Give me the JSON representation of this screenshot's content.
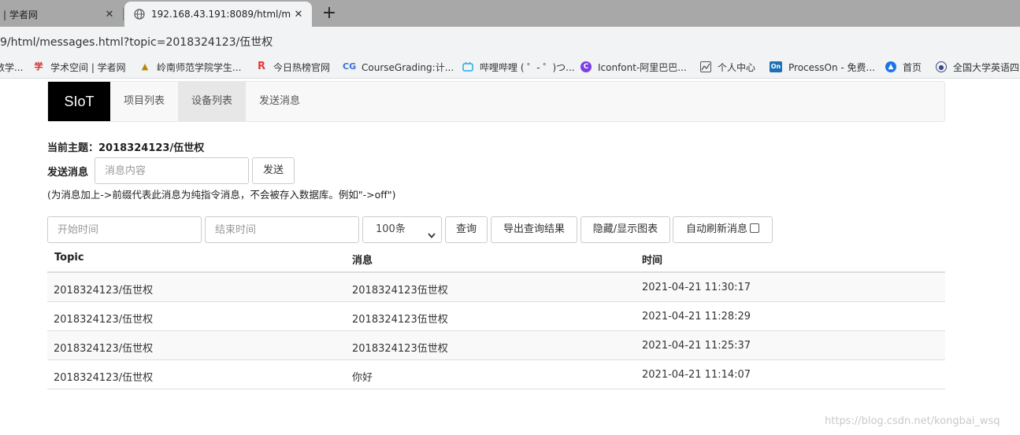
{
  "browser": {
    "tabs": [
      {
        "title": "| 学者网",
        "close": "✕",
        "active": false
      },
      {
        "title": "192.168.43.191:8089/html/me",
        "close": "✕",
        "active": true
      }
    ],
    "new_tab": "+",
    "address": "9/html/messages.html?topic=2018324123/伍世权",
    "bookmarks": [
      {
        "label": "数学...",
        "icon": "partial-icon",
        "color": "#888888"
      },
      {
        "label": "学术空间 | 学者网",
        "icon": "scholar-logo-icon",
        "color": "#d0342c"
      },
      {
        "label": "岭南师范学院学生...",
        "icon": "university-logo-icon",
        "color": "#b8860b"
      },
      {
        "label": "今日热榜官网",
        "icon": "letter-r-icon",
        "color": "#e8383d"
      },
      {
        "label": "CourseGrading:计...",
        "icon": "coursegrading-icon",
        "color": "#3b6fd8"
      },
      {
        "label": "哔哩哔哩 ( ゜- ゜)つ...",
        "icon": "bilibili-icon",
        "color": "#23ade5"
      },
      {
        "label": "Iconfont-阿里巴巴...",
        "icon": "iconfont-icon",
        "color": "#7b3fe4"
      },
      {
        "label": "个人中心",
        "icon": "chart-thumbnail-icon",
        "color": "#555555"
      },
      {
        "label": "ProcessOn - 免费...",
        "icon": "processon-icon",
        "color": "#1d6fb8"
      },
      {
        "label": "首页",
        "icon": "home-logo-icon",
        "color": "#1a73e8"
      },
      {
        "label": "全国大学英语四",
        "icon": "cet-logo-icon",
        "color": "#3a4a8a"
      }
    ]
  },
  "nav": {
    "brand": "SIoT",
    "links": [
      {
        "label": "项目列表",
        "active": false
      },
      {
        "label": "设备列表",
        "active": true
      },
      {
        "label": "发送消息",
        "active": false
      }
    ]
  },
  "topic": {
    "text": "当前主题：2018324123/伍世权"
  },
  "send": {
    "label": "发送消息",
    "placeholder": "消息内容",
    "button": "发送",
    "hint": "(为消息加上->前缀代表此消息为纯指令消息，不会被存入数据库。例如\"->off\")"
  },
  "query": {
    "start_placeholder": "开始时间",
    "end_placeholder": "结束时间",
    "limit_selected": "100条",
    "query_button": "查询",
    "export_button": "导出查询结果",
    "toggle_chart_button": "隐藏/显示图表",
    "auto_refresh_label": "自动刷新消息"
  },
  "table": {
    "headers": [
      "Topic",
      "消息",
      "时间"
    ],
    "rows": [
      [
        "2018324123/伍世权",
        "2018324123伍世权",
        "2021-04-21 11:30:17"
      ],
      [
        "2018324123/伍世权",
        "2018324123伍世权",
        "2021-04-21 11:28:29"
      ],
      [
        "2018324123/伍世权",
        "2018324123伍世权",
        "2021-04-21 11:25:37"
      ],
      [
        "2018324123/伍世权",
        "你好",
        "2021-04-21 11:14:07"
      ]
    ]
  },
  "watermark": "https://blog.csdn.net/kongbai_wsq"
}
